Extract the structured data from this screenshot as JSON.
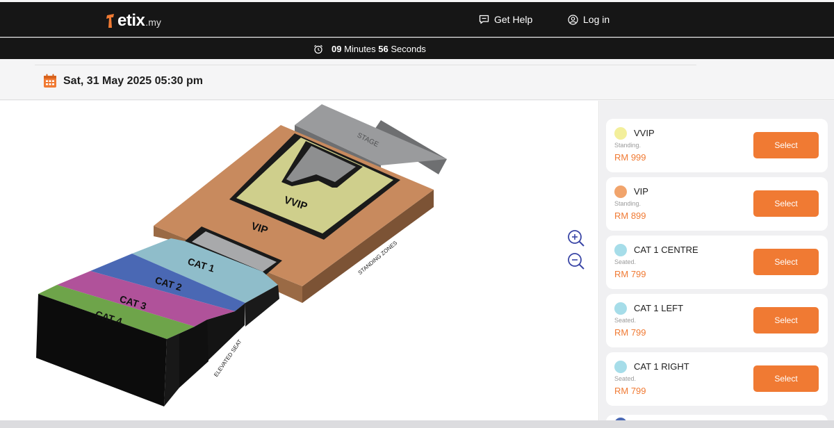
{
  "header": {
    "logo_text": "etix",
    "logo_suffix": ".my",
    "get_help": "Get Help",
    "login": "Log in"
  },
  "timer": {
    "minutes": "09",
    "minutes_label": "Minutes",
    "seconds": "56",
    "seconds_label": "Seconds"
  },
  "event": {
    "date": "Sat, 31 May 2025 05:30 pm"
  },
  "map": {
    "labels": {
      "stage": "STAGE",
      "vvip": "VVIP",
      "vip": "VIP",
      "cat1": "CAT 1",
      "cat2": "CAT 2",
      "cat3": "CAT 3",
      "cat4": "CAT 4",
      "standing_zones": "STANDING ZONES",
      "elevated_seat": "ELEVATED SEAT"
    }
  },
  "sections": [
    {
      "name": "VVIP",
      "type": "Standing.",
      "price": "RM 999",
      "color": "#f3ef9b",
      "button": "Select"
    },
    {
      "name": "VIP",
      "type": "Standing.",
      "price": "RM 899",
      "color": "#f1a46c",
      "button": "Select"
    },
    {
      "name": "CAT 1 CENTRE",
      "type": "Seated.",
      "price": "RM 799",
      "color": "#a6dde9",
      "button": "Select"
    },
    {
      "name": "CAT 1 LEFT",
      "type": "Seated.",
      "price": "RM 799",
      "color": "#a6dde9",
      "button": "Select"
    },
    {
      "name": "CAT 1 RIGHT",
      "type": "Seated.",
      "price": "RM 799",
      "color": "#a6dde9",
      "button": "Select"
    }
  ],
  "colors": {
    "accent": "#f07a33",
    "dark": "#161616",
    "stage": "#9a9b9d",
    "vip": "#c88a5e",
    "vvip": "#cfcf8c",
    "cat1": "#8fbdca",
    "cat2": "#4a68b4",
    "cat3": "#b0529a",
    "cat4": "#6ea44a"
  },
  "icons": {
    "logo": "etix-logo-icon",
    "help": "chat-bubble-icon",
    "login": "user-circle-icon",
    "timer": "alarm-clock-icon",
    "calendar": "calendar-icon",
    "zoom_in": "zoom-in-icon",
    "zoom_out": "zoom-out-icon"
  }
}
